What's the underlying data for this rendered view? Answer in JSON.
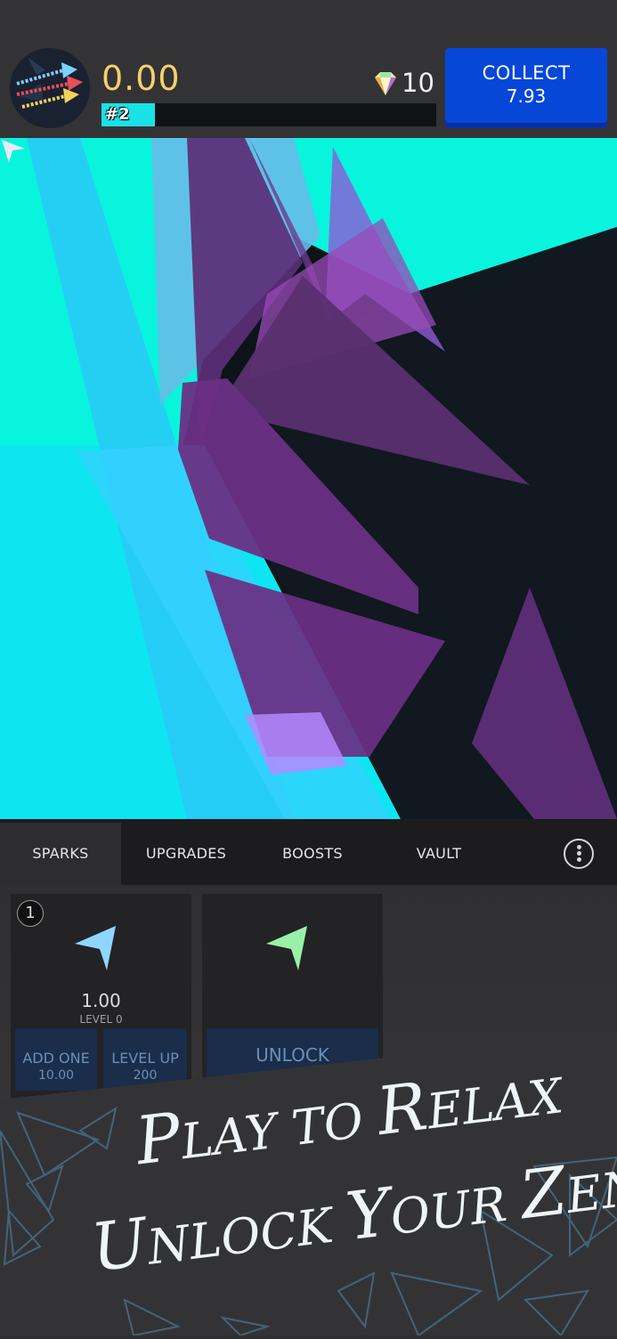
{
  "header": {
    "score": "0.00",
    "rank_label": "#2",
    "rank_progress": 0.16,
    "gems": "10",
    "collect_label": "COLLECT",
    "collect_value": "7.93"
  },
  "tabs": [
    {
      "label": "SPARKS",
      "active": true
    },
    {
      "label": "UPGRADES",
      "active": false
    },
    {
      "label": "BOOSTS",
      "active": false
    },
    {
      "label": "VAULT",
      "active": false
    }
  ],
  "more_icon": "vertical-ellipsis-icon",
  "cards": [
    {
      "badge": "1",
      "icon": "spark-arrow-icon",
      "icon_color": "#8fd6ff",
      "value": "1.00",
      "level": "LEVEL 0",
      "buttons": [
        {
          "label": "ADD ONE",
          "sub": "10.00"
        },
        {
          "label": "LEVEL UP",
          "sub": "200"
        }
      ]
    },
    {
      "icon": "spark-arrow-icon",
      "icon_color": "#9af0a8",
      "buttons": [
        {
          "label": "UNLOCK"
        }
      ]
    }
  ],
  "promo": {
    "line1": {
      "c1": "P",
      "w1": "LAY ",
      "w2": "TO ",
      "c2": "R",
      "w3": "ELAX"
    },
    "line2": {
      "c1": "U",
      "w1": "NLOCK ",
      "c2": "Y",
      "w2": "OUR ",
      "c3": "Z",
      "w3": "EN"
    }
  },
  "colors": {
    "accent": "#0647d8",
    "score": "#f4cf6e",
    "rank_fill": "#19e1e6"
  }
}
